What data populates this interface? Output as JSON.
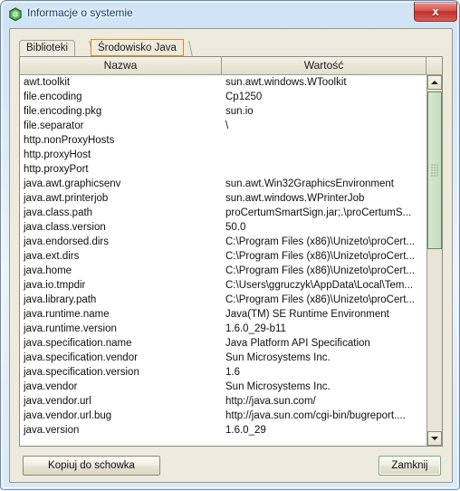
{
  "window": {
    "title": "Informacje o systemie",
    "icon": "app-hexagon-icon",
    "close_label": "x"
  },
  "tabs": [
    {
      "label": "Biblioteki",
      "selected": false
    },
    {
      "label": "Środowisko Java",
      "selected": true
    }
  ],
  "table": {
    "columns": [
      "Nazwa",
      "Wartość"
    ],
    "rows": [
      {
        "name": "awt.toolkit",
        "value": "sun.awt.windows.WToolkit"
      },
      {
        "name": "file.encoding",
        "value": "Cp1250"
      },
      {
        "name": "file.encoding.pkg",
        "value": "sun.io"
      },
      {
        "name": "file.separator",
        "value": "\\"
      },
      {
        "name": "http.nonProxyHosts",
        "value": ""
      },
      {
        "name": "http.proxyHost",
        "value": ""
      },
      {
        "name": "http.proxyPort",
        "value": ""
      },
      {
        "name": "java.awt.graphicsenv",
        "value": "sun.awt.Win32GraphicsEnvironment"
      },
      {
        "name": "java.awt.printerjob",
        "value": "sun.awt.windows.WPrinterJob"
      },
      {
        "name": "java.class.path",
        "value": "proCertumSmartSign.jar;.\\proCertumS..."
      },
      {
        "name": "java.class.version",
        "value": "50.0"
      },
      {
        "name": "java.endorsed.dirs",
        "value": "C:\\Program Files (x86)\\Unizeto\\proCert..."
      },
      {
        "name": "java.ext.dirs",
        "value": "C:\\Program Files (x86)\\Unizeto\\proCert..."
      },
      {
        "name": "java.home",
        "value": "C:\\Program Files (x86)\\Unizeto\\proCert..."
      },
      {
        "name": "java.io.tmpdir",
        "value": "C:\\Users\\ggruczyk\\AppData\\Local\\Tem..."
      },
      {
        "name": "java.library.path",
        "value": "C:\\Program Files (x86)\\Unizeto\\proCert..."
      },
      {
        "name": "java.runtime.name",
        "value": "Java(TM) SE Runtime Environment"
      },
      {
        "name": "java.runtime.version",
        "value": "1.6.0_29-b11"
      },
      {
        "name": "java.specification.name",
        "value": "Java Platform API Specification"
      },
      {
        "name": "java.specification.vendor",
        "value": "Sun Microsystems Inc."
      },
      {
        "name": "java.specification.version",
        "value": "1.6"
      },
      {
        "name": "java.vendor",
        "value": "Sun Microsystems Inc."
      },
      {
        "name": "java.vendor.url",
        "value": "http://java.sun.com/"
      },
      {
        "name": "java.vendor.url.bug",
        "value": "http://java.sun.com/cgi-bin/bugreport...."
      },
      {
        "name": "java.version",
        "value": "1.6.0_29"
      }
    ]
  },
  "scrollbar": {
    "up_arrow": "scroll-up-arrow",
    "down_arrow": "scroll-down-arrow"
  },
  "buttons": {
    "copy": "Kopiuj do schowka",
    "close": "Zamknij"
  },
  "colors": {
    "accent_tab_border": "#e08a1e",
    "titlebar_text": "#0b3b63",
    "close_red": "#bf2f2c",
    "scroll_thumb_green": "#c6dcc2",
    "panel_bg": "#edeade"
  }
}
